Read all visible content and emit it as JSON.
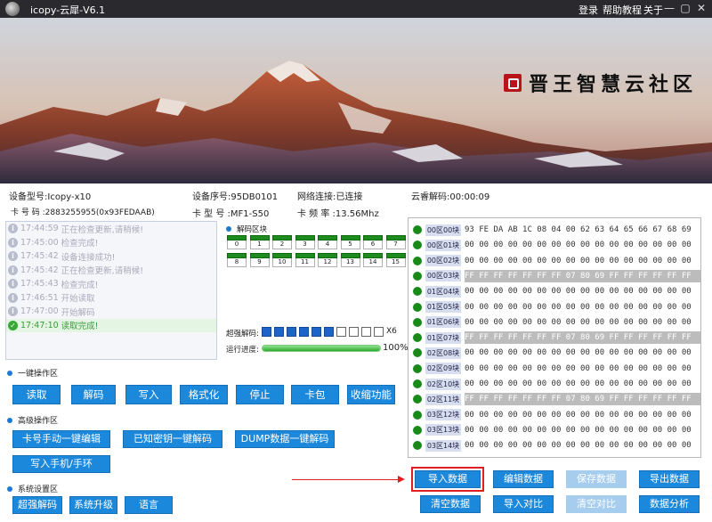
{
  "titlebar": {
    "title": "icopy-云犀-V6.1",
    "login": "登录",
    "help": "帮助教程",
    "about": "关于",
    "minimize": "—",
    "maximize": "▢",
    "close": "✕"
  },
  "banner": {
    "brand_text": "晋王智慧云社区"
  },
  "info": {
    "device_model": "设备型号:Icopy-x10",
    "device_serial": "设备序号:95DB0101",
    "network": "网络连接:已连接",
    "cloud_decode": "云睿解码:00:00:09",
    "card_number": "卡 号 码 :2883255955(0x93FEDAAB)",
    "card_type": "卡 型 号 :MF1-S50",
    "card_freq": "卡 频 率 :13.56Mhz"
  },
  "log": [
    {
      "time": "17:44:59",
      "msg": "正在检查更新,请稍候!",
      "done": false
    },
    {
      "time": "17:45:00",
      "msg": "检查完成!",
      "done": false
    },
    {
      "time": "17:45:42",
      "msg": "设备连接成功!",
      "done": false
    },
    {
      "time": "17:45:42",
      "msg": "正在检查更新,请稍候!",
      "done": false
    },
    {
      "time": "17:45:43",
      "msg": "检查完成!",
      "done": false
    },
    {
      "time": "17:46:51",
      "msg": "开始读取",
      "done": false
    },
    {
      "time": "17:47:00",
      "msg": "开始解码",
      "done": false
    },
    {
      "time": "17:47:10",
      "msg": "读取完成!",
      "done": true
    }
  ],
  "decode": {
    "block_header": "解码区块",
    "blocks": [
      "0",
      "1",
      "2",
      "3",
      "4",
      "5",
      "6",
      "7",
      "8",
      "9",
      "10",
      "11",
      "12",
      "13",
      "14",
      "15"
    ],
    "boost_label": "超强解码:",
    "boost_filled": 6,
    "boost_total": 10,
    "boost_mult": "X6",
    "progress_label": "运行进度:",
    "progress": 1.0,
    "progress_text": "100%"
  },
  "hex_rows": [
    {
      "label": "00区00块",
      "data": "93 FE DA AB 1C 08 04 00 62 63 64 65 66 67 68 69",
      "hl": false
    },
    {
      "label": "00区01块",
      "data": "00 00 00 00 00 00 00 00 00 00 00 00 00 00 00 00",
      "hl": false
    },
    {
      "label": "00区02块",
      "data": "00 00 00 00 00 00 00 00 00 00 00 00 00 00 00 00",
      "hl": false
    },
    {
      "label": "00区03块",
      "data": "FF FF FF FF FF FF FF 07 80 69 FF FF FF FF FF FF",
      "hl": true
    },
    {
      "label": "01区04块",
      "data": "00 00 00 00 00 00 00 00 00 00 00 00 00 00 00 00",
      "hl": false
    },
    {
      "label": "01区05块",
      "data": "00 00 00 00 00 00 00 00 00 00 00 00 00 00 00 00",
      "hl": false
    },
    {
      "label": "01区06块",
      "data": "00 00 00 00 00 00 00 00 00 00 00 00 00 00 00 00",
      "hl": false
    },
    {
      "label": "01区07块",
      "data": "FF FF FF FF FF FF FF 07 80 69 FF FF FF FF FF FF",
      "hl": true
    },
    {
      "label": "02区08块",
      "data": "00 00 00 00 00 00 00 00 00 00 00 00 00 00 00 00",
      "hl": false
    },
    {
      "label": "02区09块",
      "data": "00 00 00 00 00 00 00 00 00 00 00 00 00 00 00 00",
      "hl": false
    },
    {
      "label": "02区10块",
      "data": "00 00 00 00 00 00 00 00 00 00 00 00 00 00 00 00",
      "hl": false
    },
    {
      "label": "02区11块",
      "data": "FF FF FF FF FF FF FF 07 80 69 FF FF FF FF FF FF",
      "hl": true
    },
    {
      "label": "03区12块",
      "data": "00 00 00 00 00 00 00 00 00 00 00 00 00 00 00 00",
      "hl": false
    },
    {
      "label": "03区13块",
      "data": "00 00 00 00 00 00 00 00 00 00 00 00 00 00 00 00",
      "hl": false
    },
    {
      "label": "03区14块",
      "data": "00 00 00 00 00 00 00 00 00 00 00 00 00 00 00 00",
      "hl": false
    }
  ],
  "sections": {
    "quick": "一键操作区",
    "advanced": "高级操作区",
    "system": "系统设置区"
  },
  "quick_buttons": [
    "读取",
    "解码",
    "写入",
    "格式化",
    "停止",
    "卡包",
    "收缩功能"
  ],
  "advanced_buttons": [
    "卡号手动一键编辑",
    "已知密钥一键解码",
    "DUMP数据一键解码",
    "写入手机/手环"
  ],
  "system_buttons": [
    "超强解码",
    "系统升级",
    "语言"
  ],
  "data_buttons": [
    {
      "label": "导入数据",
      "disabled": false
    },
    {
      "label": "编辑数据",
      "disabled": false
    },
    {
      "label": "保存数据",
      "disabled": true
    },
    {
      "label": "导出数据",
      "disabled": false
    },
    {
      "label": "清空数据",
      "disabled": false
    },
    {
      "label": "导入对比",
      "disabled": false
    },
    {
      "label": "清空对比",
      "disabled": true
    },
    {
      "label": "数据分析",
      "disabled": false
    }
  ],
  "colors": {
    "accent": "#1b88dc",
    "disabled": "#a6cdee",
    "highlight": "#e02020",
    "ok": "#198a1a",
    "titlebar": "#2a2a2e"
  }
}
